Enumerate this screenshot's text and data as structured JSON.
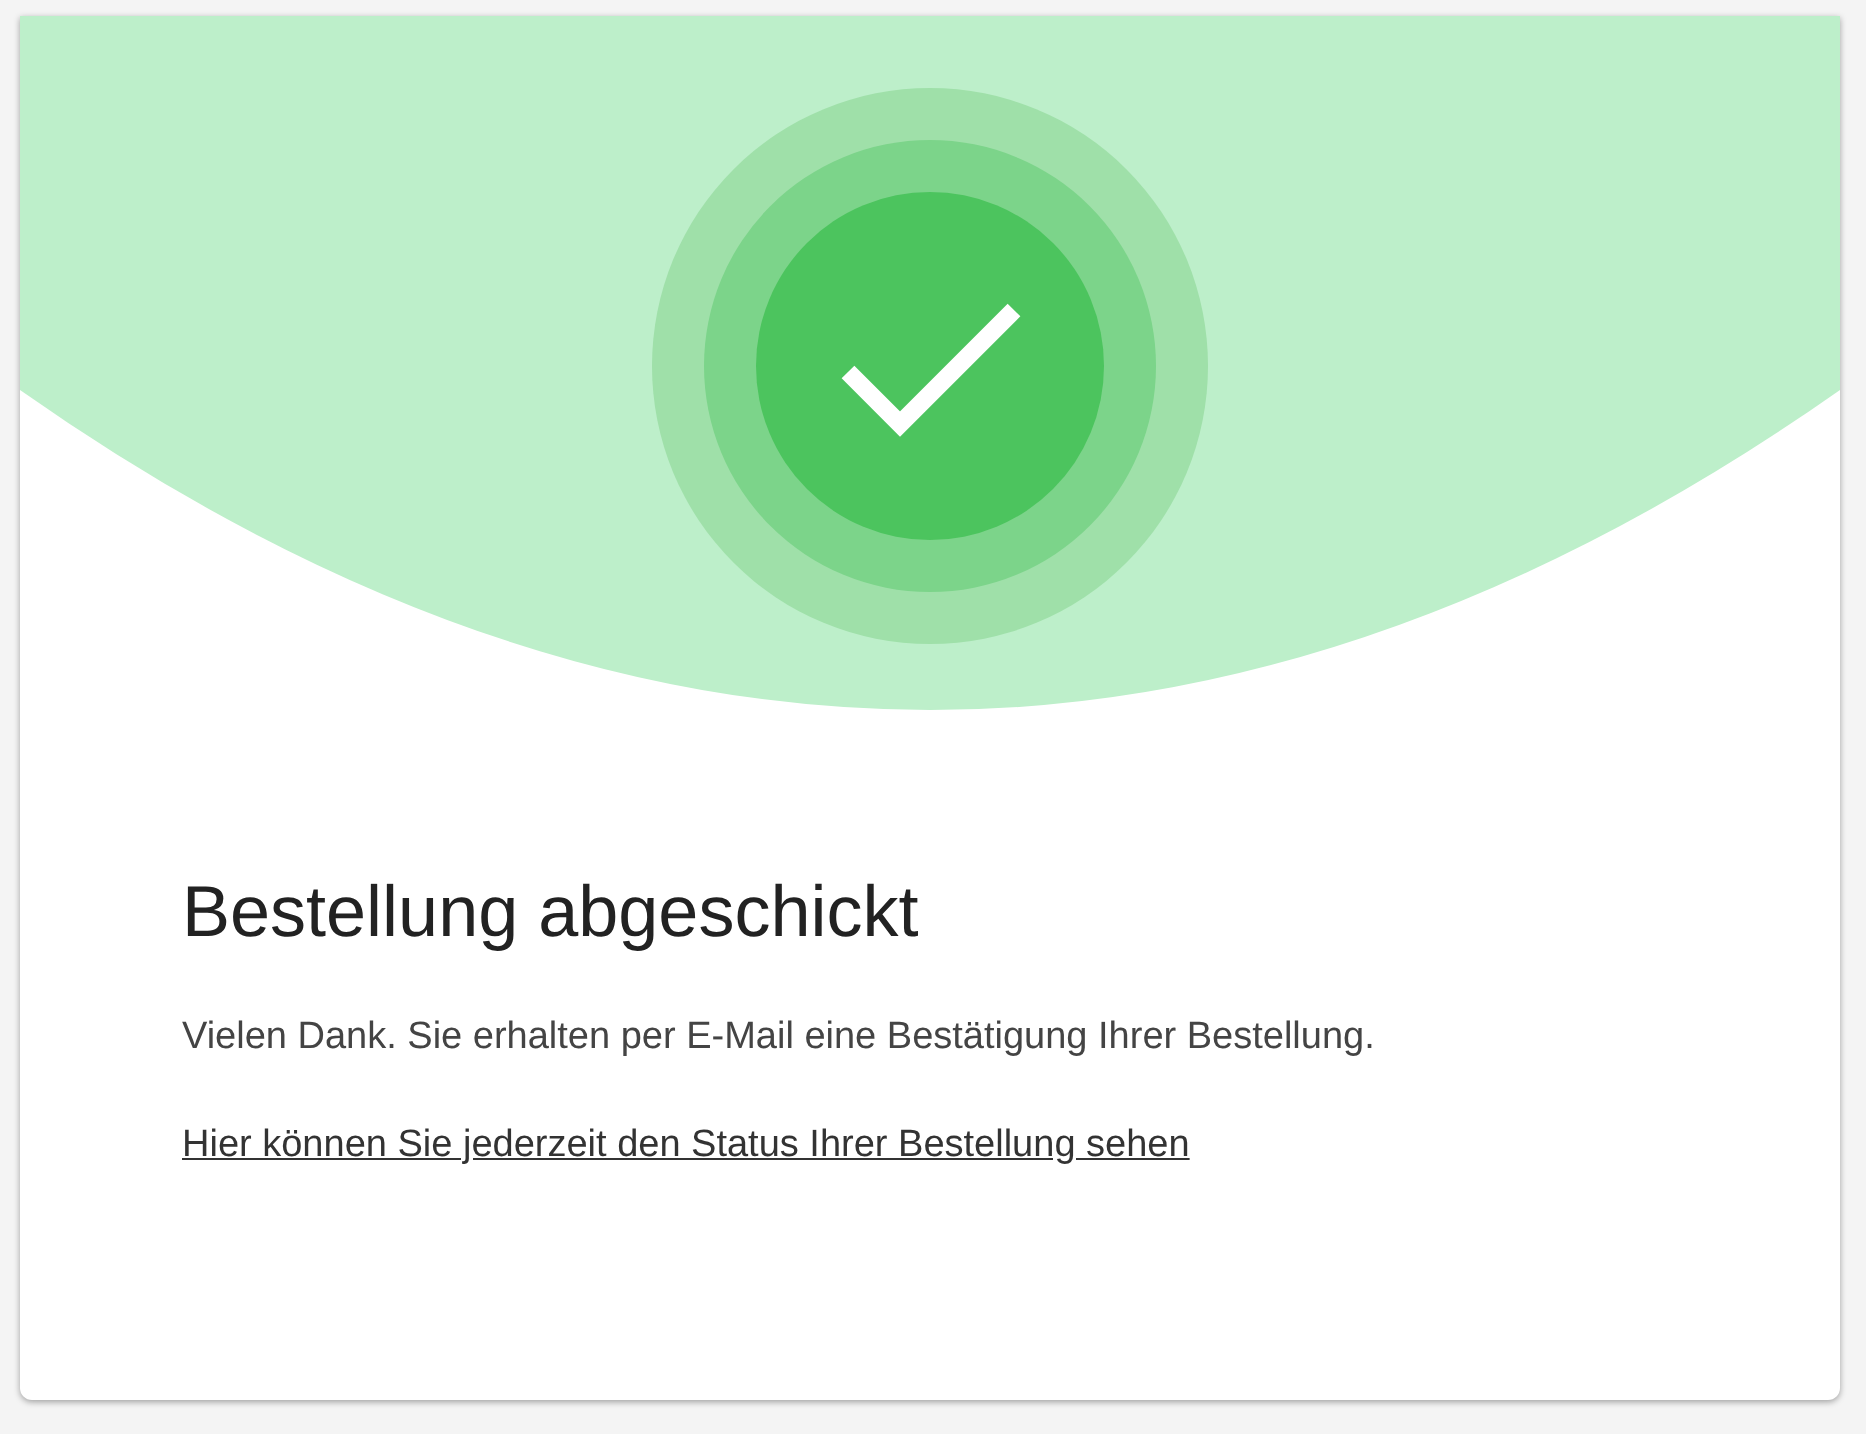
{
  "confirmation": {
    "title": "Bestellung abgeschickt",
    "message": "Vielen Dank. Sie erhalten per E-Mail eine Bestätigung Ihrer Bestellung.",
    "status_link": "Hier können Sie jederzeit den Status Ihrer Bestellung sehen"
  }
}
